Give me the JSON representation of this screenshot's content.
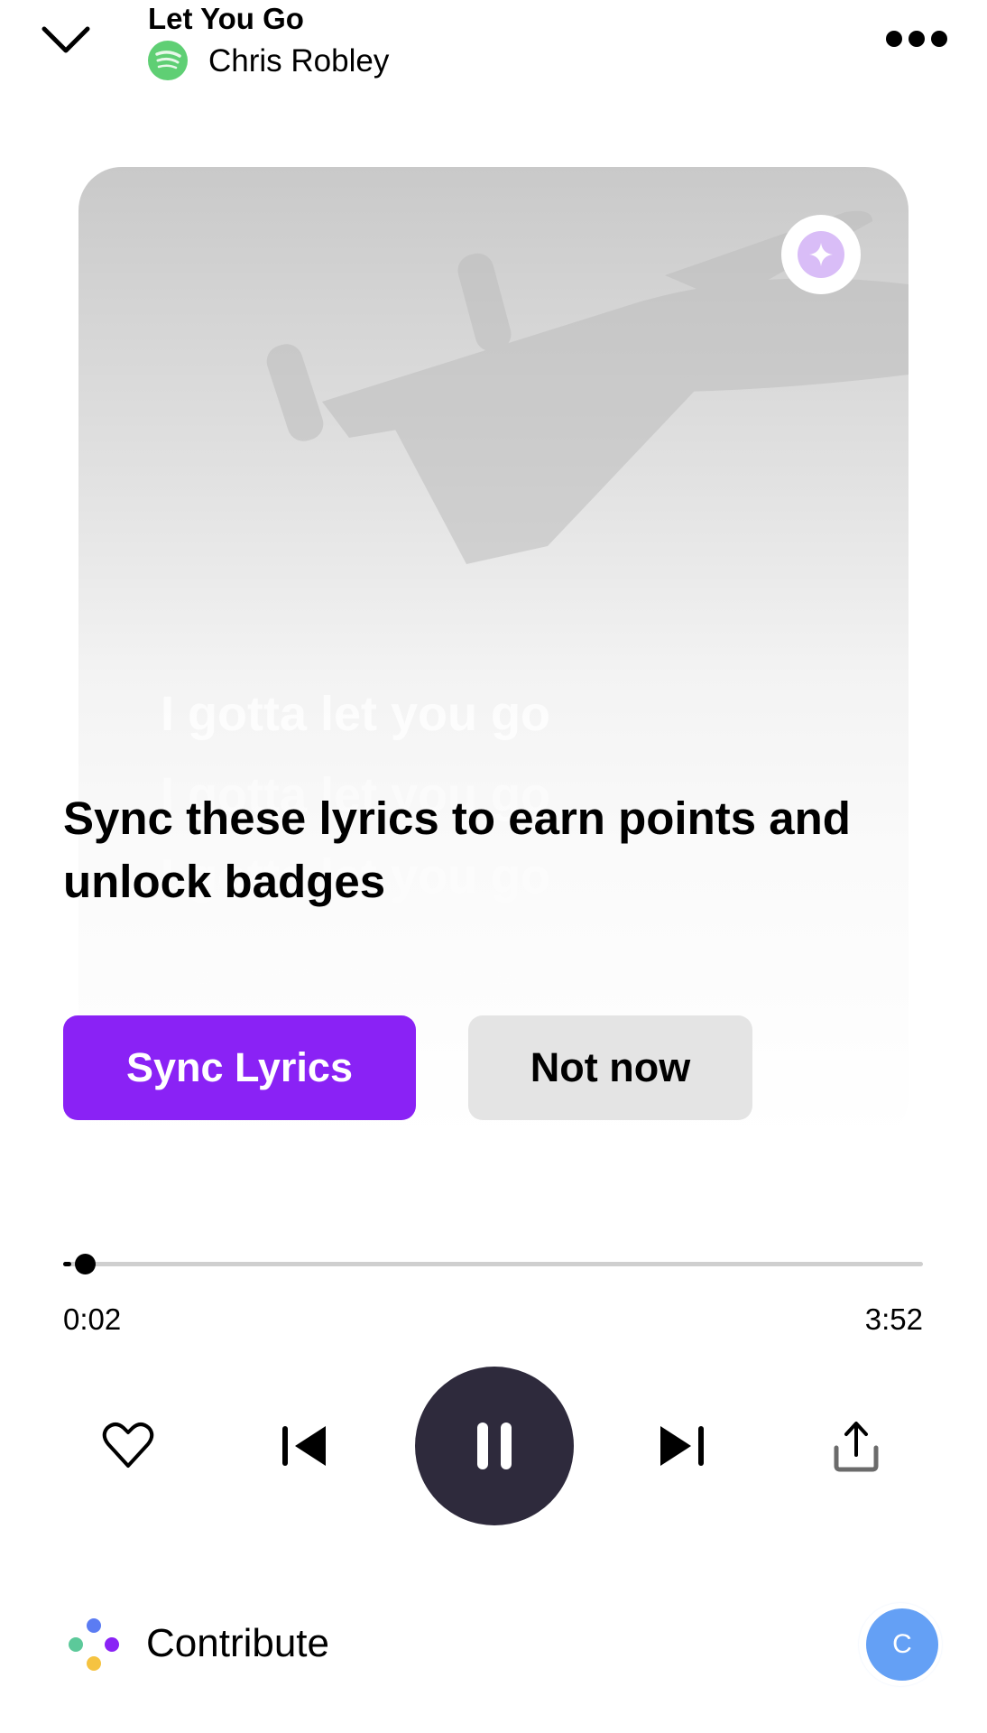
{
  "header": {
    "title": "Let You Go",
    "artist": "Chris Robley",
    "source_icon": "spotify-icon",
    "collapse_icon": "chevron-down-icon",
    "more_icon": "more-horizontal-icon"
  },
  "card": {
    "lyrics": [
      "I gotta let you go",
      "I gotta let you go",
      "I gotta let you go",
      "I gotta let you go"
    ],
    "sparkle_icon": "sparkle-icon"
  },
  "prompt": {
    "heading": "Sync these lyrics to earn points and unlock badges",
    "sync_label": "Sync Lyrics",
    "dismiss_label": "Not now"
  },
  "player": {
    "elapsed": "0:02",
    "total": "3:52",
    "progress_fraction": 0.009,
    "controls": [
      "heart-icon",
      "previous-icon",
      "pause-icon",
      "next-icon",
      "share-icon"
    ]
  },
  "footer": {
    "contribute_label": "Contribute",
    "avatar_initial": "C"
  },
  "colors": {
    "accent": "#8a22f5",
    "play_button": "#2e2a3c",
    "spotify": "#5fcf74",
    "avatar": "#64a0f5"
  }
}
